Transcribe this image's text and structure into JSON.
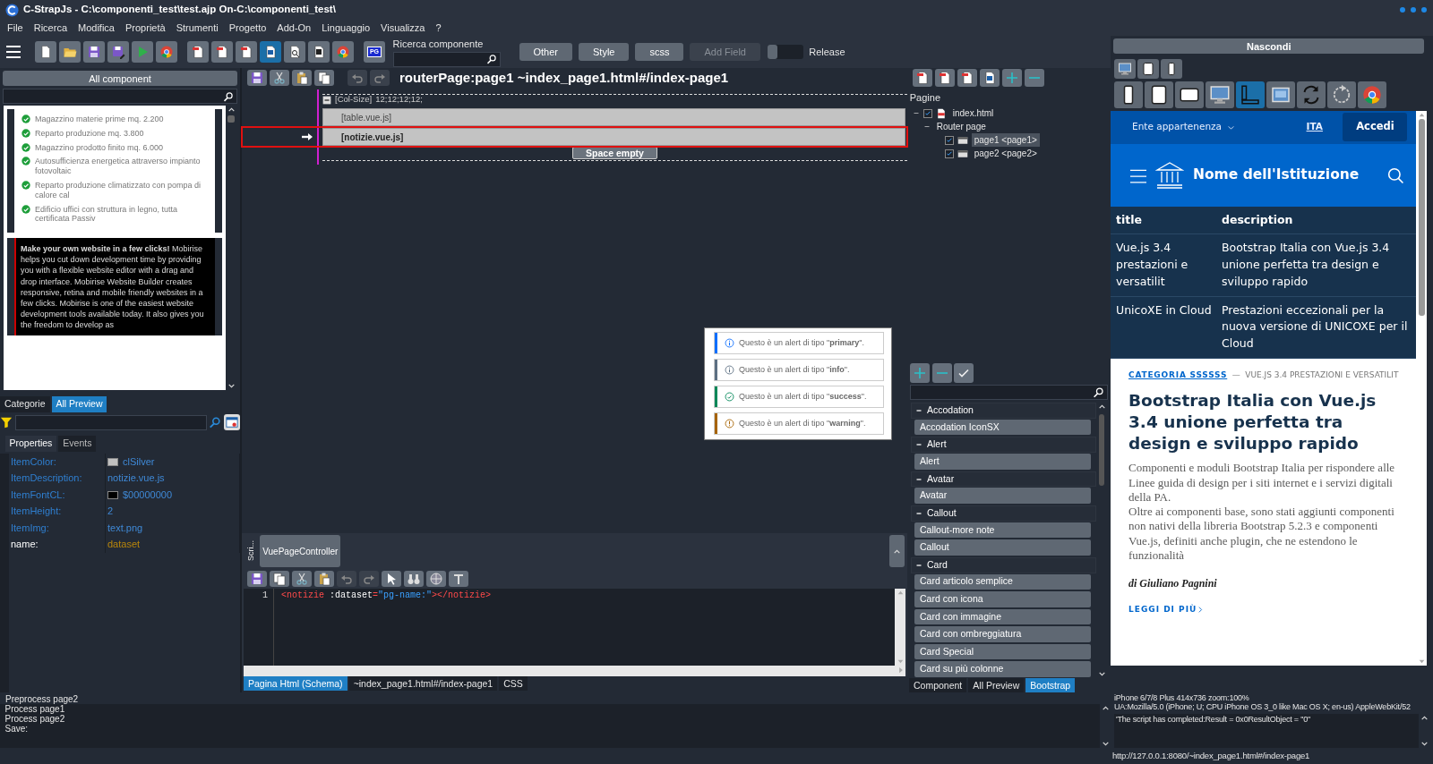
{
  "window": {
    "title": "C-StrapJs - C:\\componenti_test\\test.ajp On-C:\\componenti_test\\"
  },
  "menu": [
    "File",
    "Ricerca",
    "Modifica",
    "Proprietà",
    "Strumenti",
    "Progetto",
    "Add-On",
    "Linguaggio",
    "Visualizza",
    "?"
  ],
  "toolbar": {
    "tools": [
      {
        "kind": "new",
        "selected": false
      },
      {
        "kind": "open",
        "selected": false
      },
      {
        "kind": "save",
        "selected": false
      },
      {
        "kind": "save-as",
        "selected": false
      },
      {
        "kind": "run",
        "selected": false
      },
      {
        "kind": "browser",
        "selected": false
      },
      {
        "kind": "page",
        "selected": false
      },
      {
        "kind": "page",
        "selected": false
      },
      {
        "kind": "page",
        "selected": false
      },
      {
        "kind": "page-blue",
        "selected": true
      },
      {
        "kind": "page-search",
        "selected": false
      },
      {
        "kind": "page-dark",
        "selected": false
      },
      {
        "kind": "browser",
        "selected": false
      },
      {
        "kind": "pg",
        "label": "PG",
        "selected": false
      }
    ],
    "search": {
      "label": "Ricerca componente"
    },
    "buttons": [
      {
        "label": "Other",
        "disabled": false
      },
      {
        "label": "Style",
        "disabled": false
      },
      {
        "label": "scss",
        "disabled": false
      },
      {
        "label": "Add Field",
        "disabled": true
      }
    ],
    "toggle": {
      "label": "Release",
      "on": false
    }
  },
  "component_panel": {
    "title": "All component",
    "previews": [
      {
        "kind": "checklist",
        "items": [
          "Magazzino materie prime mq. 2.200",
          "Reparto produzione mq. 3.800",
          "Magazzino prodotto finito mq. 6.000",
          "Autosufficienza energetica attraverso impianto fotovoltaic",
          "Reparto produzione climatizzato con pompa di calore cal",
          "Edificio uffici con struttura in legno, tutta certificata Passiv"
        ]
      },
      {
        "kind": "promo",
        "text": "**Make your own website in a few clicks!** Mobirise helps you cut down development time by providing you with a flexible website editor with a drag and drop interface. Mobirise Website Builder creates responsive, retina and mobile friendly websites in a few clicks. Mobirise is one of the easiest website development tools available today. It also gives you the freedom to develop as"
      }
    ],
    "tabs": [
      {
        "label": "Categorie",
        "selected": false
      },
      {
        "label": "All Preview",
        "selected": true
      }
    ]
  },
  "inspector": {
    "tabs": [
      {
        "label": "Properties",
        "selected": true
      },
      {
        "label": "Events",
        "selected": false
      }
    ],
    "properties": [
      {
        "name": "ItemColor:",
        "value": "clSilver",
        "color": "#c0c0c0",
        "kind": "property"
      },
      {
        "name": "ItemDescription:",
        "value": "notizie.vue.js",
        "kind": "property"
      },
      {
        "name": "ItemFontCL:",
        "value": "$00000000",
        "color": "#000000",
        "kind": "property"
      },
      {
        "name": "ItemHeight:",
        "value": "2",
        "kind": "property"
      },
      {
        "name": "ItemImg:",
        "value": "text.png",
        "kind": "property"
      },
      {
        "name": "name:",
        "value": "dataset",
        "kind": "binding"
      }
    ]
  },
  "designer": {
    "tools": [
      {
        "kind": "save",
        "disabled": false
      },
      {
        "kind": "cut",
        "disabled": false
      },
      {
        "kind": "paste",
        "disabled": false
      },
      {
        "kind": "copy",
        "disabled": false
      },
      {
        "kind": "undo",
        "disabled": true
      },
      {
        "kind": "redo",
        "disabled": true
      }
    ],
    "title": "routerPage:page1 ~index_page1.html#/index-page1",
    "container": {
      "label": "[Col-Size]",
      "value": "12;12;12;12;"
    },
    "rows": [
      {
        "label": "[table.vue.js]",
        "selected": false
      },
      {
        "label": "[notizie.vue.js]",
        "selected": true
      }
    ],
    "space": "Space empty",
    "alert_preview": [
      {
        "text": "Questo è un alert di tipo \"**primary**\".",
        "kind": "info",
        "color": "#0d6efd"
      },
      {
        "text": "Questo è un alert di tipo \"**info**\".",
        "kind": "info",
        "color": "#5c6f82"
      },
      {
        "text": "Questo è un alert di tipo \"**success**\".",
        "kind": "success",
        "color": "#008758"
      },
      {
        "text": "Questo è un alert di tipo \"**warning**\".",
        "kind": "warning",
        "color": "#a66300"
      }
    ]
  },
  "script": {
    "side_label": "Scri...",
    "tabs": [
      {
        "label": "VuePageController",
        "selected": true
      }
    ],
    "tools": [
      {
        "kind": "save",
        "disabled": false
      },
      {
        "kind": "copy",
        "disabled": false
      },
      {
        "kind": "cut",
        "disabled": false
      },
      {
        "kind": "paste",
        "disabled": false
      },
      {
        "kind": "undo",
        "disabled": true
      },
      {
        "kind": "redo",
        "disabled": true
      },
      {
        "kind": "pointer",
        "disabled": false
      },
      {
        "kind": "find",
        "disabled": false
      },
      {
        "kind": "inspect",
        "disabled": false
      },
      {
        "kind": "format",
        "disabled": false
      }
    ],
    "lines": [
      {
        "number": "1",
        "tokens": [
          {
            "kind": "tag",
            "text": "<notizie"
          },
          {
            "kind": "attr",
            "text": " :dataset"
          },
          {
            "kind": "tag",
            "text": "="
          },
          {
            "kind": "string",
            "text": "\"pg-name:\""
          },
          {
            "kind": "tag",
            "text": "></notizie>"
          }
        ]
      }
    ]
  },
  "center_tabs": [
    {
      "label": "Pagina Html (Schema)",
      "selected": true
    },
    {
      "label": "~index_page1.html#/index-page1",
      "selected": false
    },
    {
      "label": "CSS",
      "selected": false
    }
  ],
  "pages": {
    "tools": [
      {
        "kind": "page"
      },
      {
        "kind": "page"
      },
      {
        "kind": "page"
      },
      {
        "kind": "page-blue"
      },
      {
        "kind": "add"
      },
      {
        "kind": "remove"
      }
    ],
    "title": "Pagine",
    "tree": [
      {
        "label": "index.html",
        "kind": "file",
        "checked": true,
        "expanded": true,
        "children": [
          {
            "label": "Router page",
            "expanded": true,
            "children": [
              {
                "label": "page1 <page1>",
                "kind": "page",
                "checked": true,
                "selected": true
              },
              {
                "label": "page2 <page2>",
                "kind": "page",
                "checked": true,
                "selected": false
              }
            ]
          }
        ]
      }
    ]
  },
  "library": {
    "tools": [
      {
        "kind": "add"
      },
      {
        "kind": "remove"
      },
      {
        "kind": "check"
      }
    ],
    "groups": [
      {
        "label": "Accodation",
        "expanded": true,
        "items": [
          "Accodation IconSX"
        ]
      },
      {
        "label": "Alert",
        "expanded": true,
        "items": [
          "Alert"
        ]
      },
      {
        "label": "Avatar",
        "expanded": true,
        "items": [
          "Avatar"
        ]
      },
      {
        "label": "Callout",
        "expanded": true,
        "items": [
          "Callout-more note",
          "Callout"
        ]
      },
      {
        "label": "Card",
        "expanded": true,
        "items": [
          "Card articolo semplice",
          "Card con icona",
          "Card con immagine",
          "Card con ombreggiatura",
          "Card Special",
          "Card su più colonne"
        ]
      }
    ],
    "tabs": [
      {
        "label": "Component",
        "selected": false
      },
      {
        "label": "All Preview",
        "selected": false
      },
      {
        "label": "Bootstrap",
        "selected": true
      }
    ]
  },
  "preview_panel": {
    "title": "Nascondi",
    "device_rows": [
      [
        {
          "kind": "desktop",
          "selected": false
        },
        {
          "kind": "tablet",
          "selected": false
        },
        {
          "kind": "phone",
          "selected": false
        }
      ],
      [
        {
          "kind": "phone",
          "selected": false
        },
        {
          "kind": "tablet",
          "selected": false
        },
        {
          "kind": "landscape",
          "selected": false
        },
        {
          "kind": "desktop",
          "selected": false
        },
        {
          "kind": "layout",
          "selected": true
        },
        {
          "kind": "window",
          "selected": false
        },
        {
          "kind": "rotate",
          "selected": false
        },
        {
          "kind": "reload",
          "selected": false
        },
        {
          "kind": "browser",
          "selected": false
        }
      ]
    ]
  },
  "site": {
    "entity": "Ente appartenenza",
    "language": "ITA",
    "login": "Accedi",
    "brand": "Nome dell'Istituzione",
    "table": {
      "columns": [
        "title",
        "description"
      ],
      "rows": [
        [
          "Vue.js 3.4 prestazioni e versatilit",
          "Bootstrap Italia con Vue.js 3.4 unione perfetta tra design e sviluppo rapido"
        ],
        [
          "UnicoXE in Cloud",
          "Prestazioni eccezionali per la nuova versione di UNICOXE per il Cloud"
        ]
      ]
    },
    "article": {
      "category": "CATEGORIA SSSSSS",
      "separator": "—",
      "topic": "VUE.JS 3.4 PRESTAZIONI E VERSATILIT",
      "title": "Bootstrap Italia con Vue.js 3.4 unione perfetta tra design e sviluppo rapido",
      "paragraphs": [
        "Componenti e moduli Bootstrap Italia per rispondere alle Linee guida di design per i siti internet e i servizi digitali della PA.",
        "Oltre ai componenti base, sono stati aggiunti componenti non nativi della libreria Bootstrap 5.2.3 e componenti Vue.js, definiti anche plugin, che ne estendono le funzionalità"
      ],
      "author": "di Giuliano Pagnini",
      "more": "LEGGI DI PIÙ"
    }
  },
  "log": {
    "title": "Preprocess page2",
    "lines": [
      "Process page1",
      "Process page2",
      "Save:"
    ]
  },
  "device_info": {
    "lines": [
      "iPhone 6/7/8 Plus 414x736 zoom:100%",
      "UA:Mozilla/5.0 (iPhone; U; CPU iPhone OS 3_0 like Mac OS X; en-us) AppleWebKit/52"
    ],
    "result": "'The script has completed:Result = 0x0ResultObject = \"0\"",
    "url": "http://127.0.0.1:8080/~index_page1.html#/index-page1"
  }
}
